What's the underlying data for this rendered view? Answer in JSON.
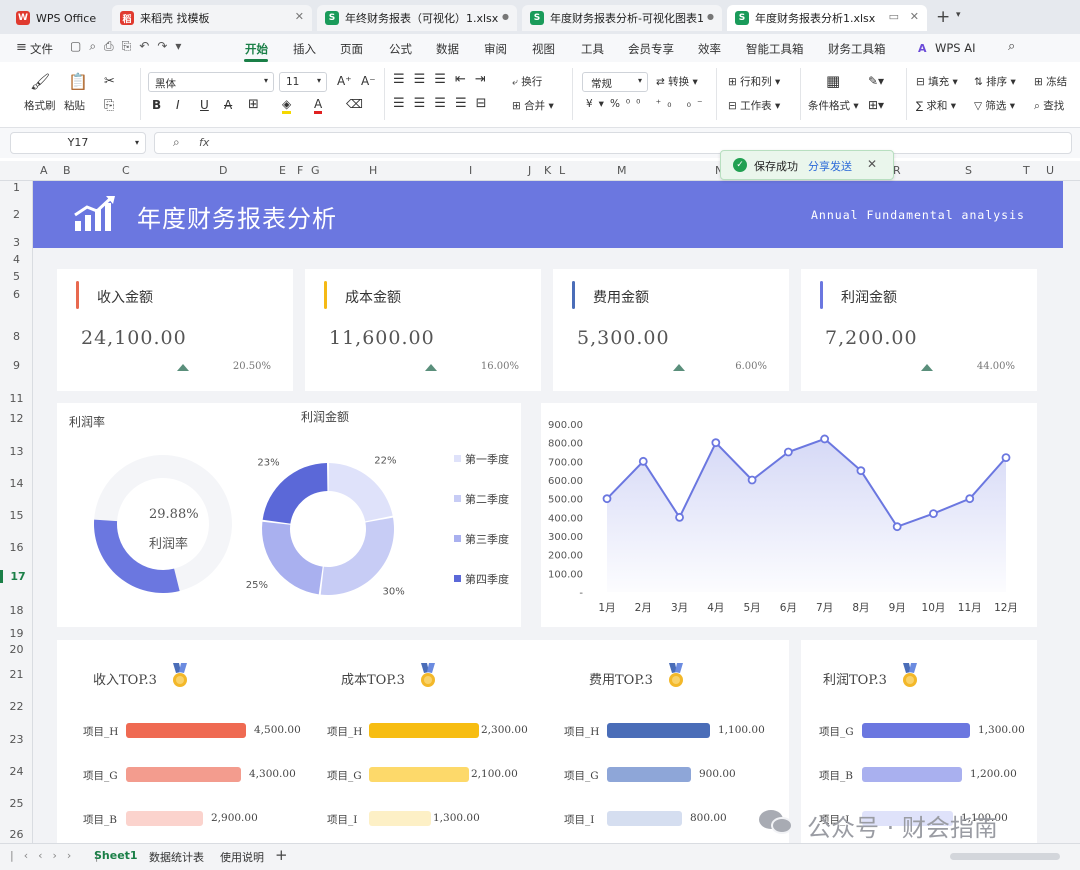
{
  "tabs": [
    {
      "label": "WPS Office",
      "icon": "wps-logo"
    },
    {
      "label": "来稻壳 找模板",
      "icon": "docer-icon"
    },
    {
      "label": "年终财务报表（可视化）1.xlsx",
      "icon": "sheet-icon"
    },
    {
      "label": "年度财务报表分析-可视化图表1",
      "icon": "sheet-icon"
    },
    {
      "label": "年度财务报表分析1.xlsx",
      "icon": "sheet-icon"
    }
  ],
  "menu": [
    "文件",
    "开始",
    "插入",
    "页面",
    "公式",
    "数据",
    "审阅",
    "视图",
    "工具",
    "会员专享",
    "效率",
    "智能工具箱",
    "财务工具箱",
    "WPS AI"
  ],
  "ribbon": {
    "format_painter": "格式刷",
    "paste": "粘贴",
    "font": "黑体",
    "size": "11",
    "number_format": "常规",
    "wrap": "换行",
    "merge": "合并",
    "convert": "转换",
    "rowcol": "行和列",
    "worksheet": "工作表",
    "cond_format": "条件格式",
    "fill": "填充",
    "sort": "排序",
    "freeze": "冻结",
    "sum": "求和",
    "filter": "筛选",
    "find": "查找"
  },
  "formula_bar": {
    "cell": "Y17",
    "fx": "fx"
  },
  "toast": {
    "text": "保存成功",
    "link": "分享发送"
  },
  "columns": [
    "A",
    "B",
    "C",
    "D",
    "E",
    "F",
    "G",
    "H",
    "I",
    "J",
    "K",
    "L",
    "M",
    "N",
    "R",
    "S",
    "T",
    "U"
  ],
  "rows": [
    "1",
    "2",
    "3",
    "4",
    "5",
    "6",
    "8",
    "9",
    "11",
    "12",
    "13",
    "14",
    "15",
    "16",
    "17",
    "18",
    "19",
    "20",
    "21",
    "22",
    "23",
    "24",
    "25",
    "26"
  ],
  "selected_row": "17",
  "dashboard": {
    "title": "年度财务报表分析",
    "subtitle": "Annual Fundamental analysis",
    "kpis": [
      {
        "label": "收入金额",
        "value": "24,100.00",
        "pct": "20.50%",
        "color": "#e8694f"
      },
      {
        "label": "成本金额",
        "value": "11,600.00",
        "pct": "16.00%",
        "color": "#f5b915"
      },
      {
        "label": "费用金额",
        "value": "5,300.00",
        "pct": "6.00%",
        "color": "#4a6db8"
      },
      {
        "label": "利润金额",
        "value": "7,200.00",
        "pct": "44.00%",
        "color": "#6b77e0"
      }
    ],
    "profit_rate": {
      "title": "利润率",
      "value": "29.88%",
      "label": "利润率"
    },
    "tops": [
      {
        "title": "收入TOP.3",
        "items": [
          {
            "name": "项目_H",
            "value": "4,500.00"
          },
          {
            "name": "项目_G",
            "value": "4,300.00"
          },
          {
            "name": "项目_B",
            "value": "2,900.00"
          }
        ],
        "colors": [
          "#ef6a52",
          "#f39c8e",
          "#fbd3cd"
        ]
      },
      {
        "title": "成本TOP.3",
        "items": [
          {
            "name": "项目_H",
            "value": "2,300.00"
          },
          {
            "name": "项目_G",
            "value": "2,100.00"
          },
          {
            "name": "项目_I",
            "value": "1,300.00"
          }
        ],
        "colors": [
          "#f7bd12",
          "#fdd96a",
          "#fdf0c6"
        ]
      },
      {
        "title": "费用TOP.3",
        "items": [
          {
            "name": "项目_H",
            "value": "1,100.00"
          },
          {
            "name": "项目_G",
            "value": "900.00"
          },
          {
            "name": "项目_I",
            "value": "800.00"
          }
        ],
        "colors": [
          "#4a6db8",
          "#8ea6d8",
          "#d5def0"
        ]
      },
      {
        "title": "利润TOP.3",
        "items": [
          {
            "name": "项目_G",
            "value": "1,300.00"
          },
          {
            "name": "项目_B",
            "value": "1,200.00"
          },
          {
            "name": "项目_I",
            "value": "1,100.00"
          }
        ],
        "colors": [
          "#6b77e0",
          "#a9b0ef",
          "#dfe2fa"
        ]
      }
    ]
  },
  "watermark": "公众号 · 财会指南",
  "sheet_tabs": [
    "Sheet1",
    "数据统计表",
    "使用说明"
  ],
  "chart_data": [
    {
      "type": "pie",
      "title": "利润率",
      "values": [
        29.88,
        70.12
      ],
      "colors": [
        "#6b77e0",
        "#f4f5f8"
      ]
    },
    {
      "type": "pie",
      "title": "利润金额",
      "categories": [
        "第一季度",
        "第二季度",
        "第三季度",
        "第四季度"
      ],
      "values": [
        22,
        30,
        25,
        23
      ],
      "labels": [
        "22%",
        "30%",
        "25%",
        "23%"
      ],
      "colors": [
        "#dfe2fa",
        "#c7ccf5",
        "#a9b0ef",
        "#5b68d8"
      ]
    },
    {
      "type": "line",
      "categories": [
        "1月",
        "2月",
        "3月",
        "4月",
        "5月",
        "6月",
        "7月",
        "8月",
        "9月",
        "10月",
        "11月",
        "12月"
      ],
      "values": [
        500,
        700,
        400,
        800,
        600,
        750,
        820,
        650,
        350,
        420,
        500,
        720
      ],
      "ylim": [
        0,
        900
      ],
      "yticks": [
        "-",
        "100.00",
        "200.00",
        "300.00",
        "400.00",
        "500.00",
        "600.00",
        "700.00",
        "800.00",
        "900.00"
      ],
      "color": "#6b77e0"
    },
    {
      "type": "bar",
      "title": "收入TOP.3",
      "categories": [
        "项目_H",
        "项目_G",
        "项目_B"
      ],
      "values": [
        4500,
        4300,
        2900
      ]
    },
    {
      "type": "bar",
      "title": "成本TOP.3",
      "categories": [
        "项目_H",
        "项目_G",
        "项目_I"
      ],
      "values": [
        2300,
        2100,
        1300
      ]
    },
    {
      "type": "bar",
      "title": "费用TOP.3",
      "categories": [
        "项目_H",
        "项目_G",
        "项目_I"
      ],
      "values": [
        1100,
        900,
        800
      ]
    },
    {
      "type": "bar",
      "title": "利润TOP.3",
      "categories": [
        "项目_G",
        "项目_B",
        "项目_I"
      ],
      "values": [
        1300,
        1200,
        1100
      ]
    }
  ]
}
